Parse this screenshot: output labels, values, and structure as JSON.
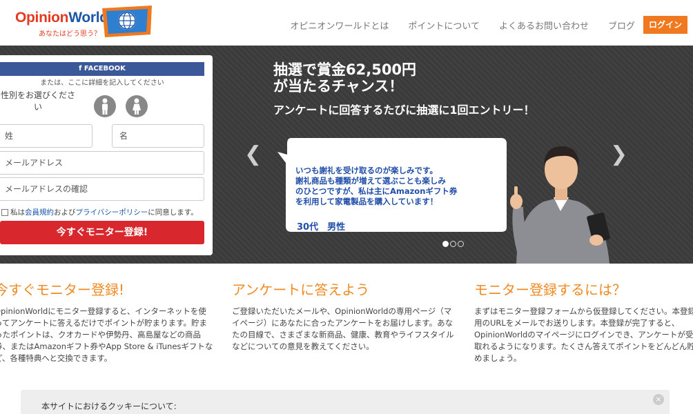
{
  "header": {
    "logo": {
      "word1": "Opinion",
      "word2": "World",
      "tagline": "あなたはどう思う？"
    },
    "nav": [
      "オピニオンワールドとは",
      "ポイントについて",
      "よくあるお問い合わせ",
      "ブログ"
    ],
    "login_label": "ログイン"
  },
  "hero": {
    "title_line1": "抽選で賞金62,500円",
    "title_line2": "が当たるチャンス！",
    "subtitle": "アンケートに回答するたびに抽選に1回エントリー！",
    "testimonial": "いつも謝礼を受け取るのが楽しみです。\n謝礼商品も種類が増えて選ぶことも楽しみ\nのひとつですが、私は主にAmazonギフト券\nを利用して家電製品を購入しています！",
    "author": "30代　男性",
    "slides_count": 3,
    "active_slide": 1
  },
  "signup": {
    "facebook_label": "f  FACEBOOK",
    "or_text": "または、ここに詳細を記入してください",
    "gender_label": "性別をお選びください",
    "last_name_placeholder": "姓",
    "first_name_placeholder": "名",
    "email_placeholder": "メールアドレス",
    "email_confirm_placeholder": "メールアドレスの確認",
    "agree_prefix": "私は",
    "terms_link": "会員規約",
    "agree_and": "および",
    "privacy_link": "プライバシーポリシー",
    "agree_suffix": "に同意します。",
    "submit_label": "今すぐモニター登録!"
  },
  "features": [
    {
      "title": "今すぐモニター登録!",
      "body": "OpinionWorldにモニター登録すると、インターネットを使ってアンケートに答えるだけでポイントが貯まります。貯まったポイントは、クオカードや伊勢丹、高島屋などの商品券、またはAmazonギフト券やApp Store & iTunesギフトなど、各種特典へと交換できます。"
    },
    {
      "title": "アンケートに答えよう",
      "body": "ご登録いただいたメールや、OpinionWorldの専用ページ（マイページ）にあなたに合ったアンケートをお届けします。あなたの目線で、さまざまな新商品、健康、教育やライフスタイルなどについての意見を教えてください。"
    },
    {
      "title": "モニター登録するには？",
      "body": "まずはモニター登録フォームから仮登録してください。本登録用のURLをメールでお送りします。本登録が完了すると、OpinionWorldのマイページにログインでき、アンケートが受け取れるようになります。たくさん答えてポイントをどんどん貯めましょう。"
    }
  ],
  "cookie": {
    "text": "本サイトにおけるクッキーについて:",
    "close": "×"
  },
  "colors": {
    "accent": "#f0791f",
    "signup": "#d9272e",
    "facebook": "#3b5998",
    "feature_title": "#f08a24"
  }
}
